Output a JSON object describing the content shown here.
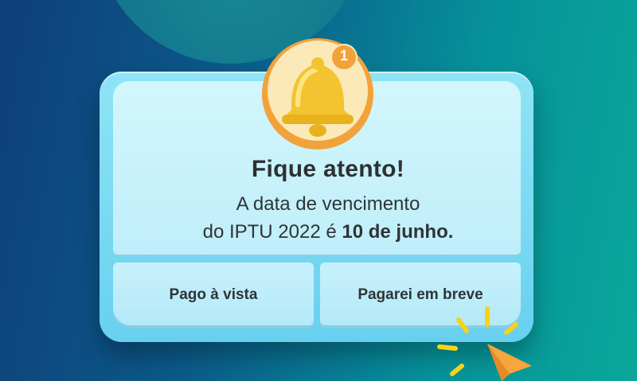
{
  "notification": {
    "badge_count": "1",
    "title": "Fique atento!",
    "message_line1": "A data de vencimento",
    "message_line2_prefix": "do IPTU 2022 é ",
    "message_line2_bold": "10 de junho."
  },
  "buttons": {
    "paid_label": "Pago à vista",
    "later_label": "Pagarei em breve"
  },
  "icons": {
    "bell": "bell-icon",
    "cursor": "cursor-click-icon"
  },
  "colors": {
    "bell_yellow": "#f4c430",
    "badge_orange": "#f2a23a",
    "card_light": "#c9f2fb"
  }
}
